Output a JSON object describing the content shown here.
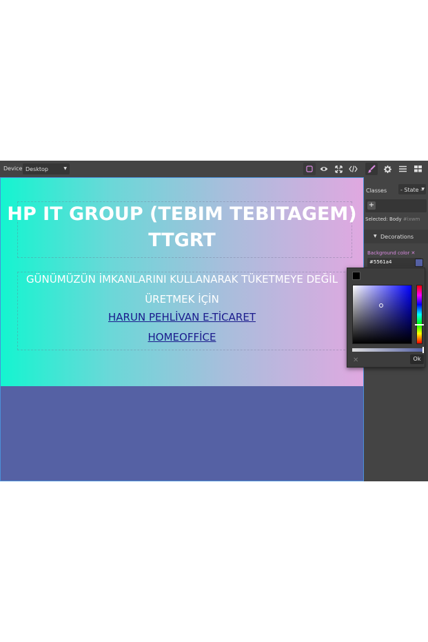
{
  "toolbar": {
    "device_label": "Device",
    "device_value": "Desktop",
    "buttons": [
      "square-border-icon",
      "eye-icon",
      "fullscreen-icon",
      "code-icon",
      "paintbrush-icon",
      "gear-icon",
      "hamburger-icon",
      "blocks-icon"
    ]
  },
  "hero": {
    "title": "HP IT GROUP (TEBIM TEBITAGEM) TTGRT",
    "subtitle": "GÜNÜMÜZÜN İMKANLARINI KULLANARAK TÜKETMEYE DEĞİL ÜRETMEK İÇİN",
    "link1": "HARUN PEHLİVAN E-TİCARET",
    "link2": "HOMEOFFİCE"
  },
  "panel": {
    "classes_label": "Classes",
    "state_value": "- State -",
    "add_label": "+",
    "selected_label": "Selected:",
    "selected_name": "Body",
    "selected_id": "#ixwm",
    "decorations_label": "Decorations",
    "bg_color_label": "Background color",
    "bg_color_clear": "✕",
    "bg_color_value": "#5561a4"
  },
  "picker": {
    "hue": "#0000ff",
    "cursor_saturation": 0.48,
    "cursor_value": 0.66,
    "hue_level": 0.67,
    "alpha": 1.0,
    "cancel_label": "✕",
    "ok_label": "Ok"
  },
  "colors": {
    "canvas_bg": "#5561a4",
    "accent_pink": "#d98ae0",
    "hero_gradient_start": "#14f5d0",
    "hero_gradient_end": "#e0a8e0",
    "link": "#1a1a8c"
  }
}
